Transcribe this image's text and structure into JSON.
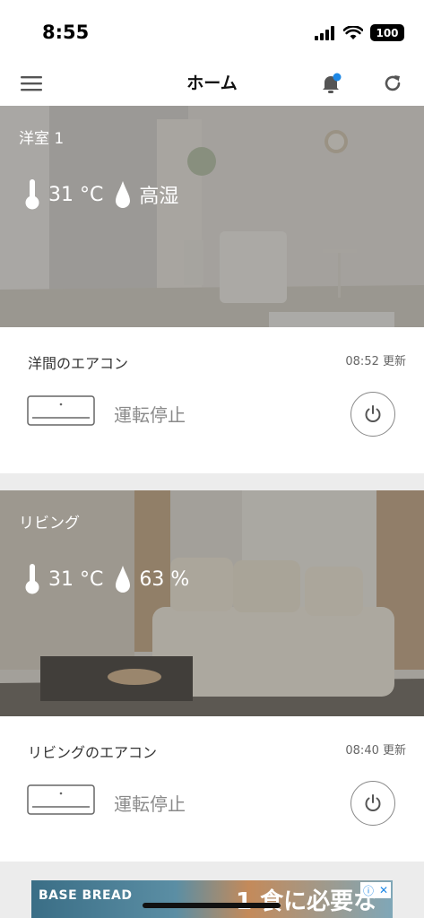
{
  "status_bar": {
    "time": "8:55",
    "battery": "100"
  },
  "navbar": {
    "title": "ホーム"
  },
  "rooms": [
    {
      "name": "洋室 1",
      "temperature": "31 °C",
      "humidity": "高湿",
      "device": {
        "name": "洋間のエアコン",
        "updated": "08:52 更新",
        "status": "運転停止"
      }
    },
    {
      "name": "リビング",
      "temperature": "31 °C",
      "humidity": "63 %",
      "device": {
        "name": "リビングのエアコン",
        "updated": "08:40 更新",
        "status": "運転停止"
      }
    }
  ],
  "ad": {
    "brand": "BASE BREAD",
    "copy": "1 食に必要な"
  },
  "colors": {
    "accent_badge": "#1e88e5",
    "overlay": "#464646"
  }
}
